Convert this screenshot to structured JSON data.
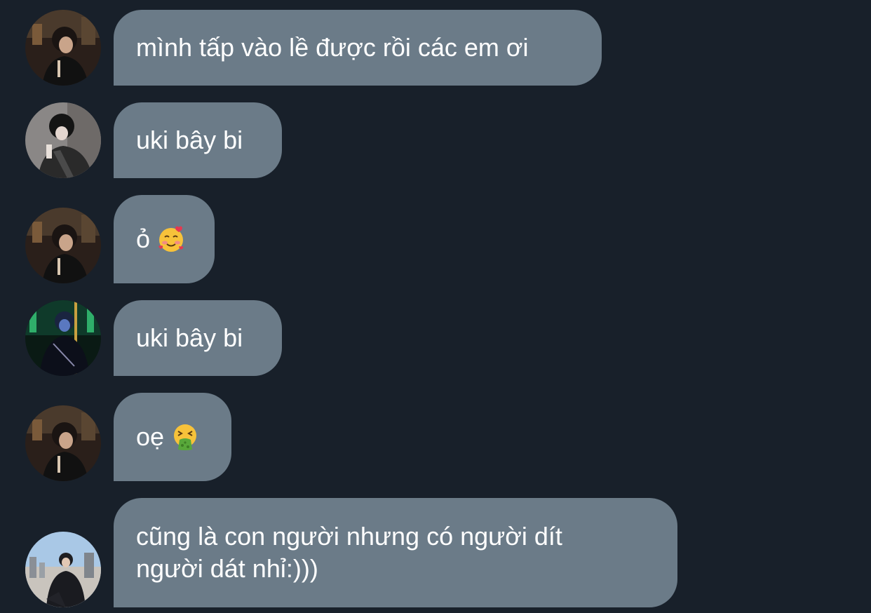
{
  "messages": [
    {
      "avatar": "avatar-dark-room",
      "text": "mình tấp vào lề được rồi các em ơi"
    },
    {
      "avatar": "avatar-grey-jacket",
      "text": "uki bây bi"
    },
    {
      "avatar": "avatar-dark-room",
      "text": "ỏ",
      "emoji": "smiling-face-with-hearts-icon"
    },
    {
      "avatar": "avatar-neon-green",
      "text": "uki bây bi"
    },
    {
      "avatar": "avatar-dark-room",
      "text": "oẹ",
      "emoji": "vomiting-face-icon"
    },
    {
      "avatar": "avatar-outdoor-sky",
      "lines": [
        "cũng là con người nhưng có người dít",
        "người dát nhỉ:)))"
      ]
    }
  ],
  "colors": {
    "background": "#18202a",
    "bubble": "#6b7b88",
    "text": "#ffffff"
  }
}
